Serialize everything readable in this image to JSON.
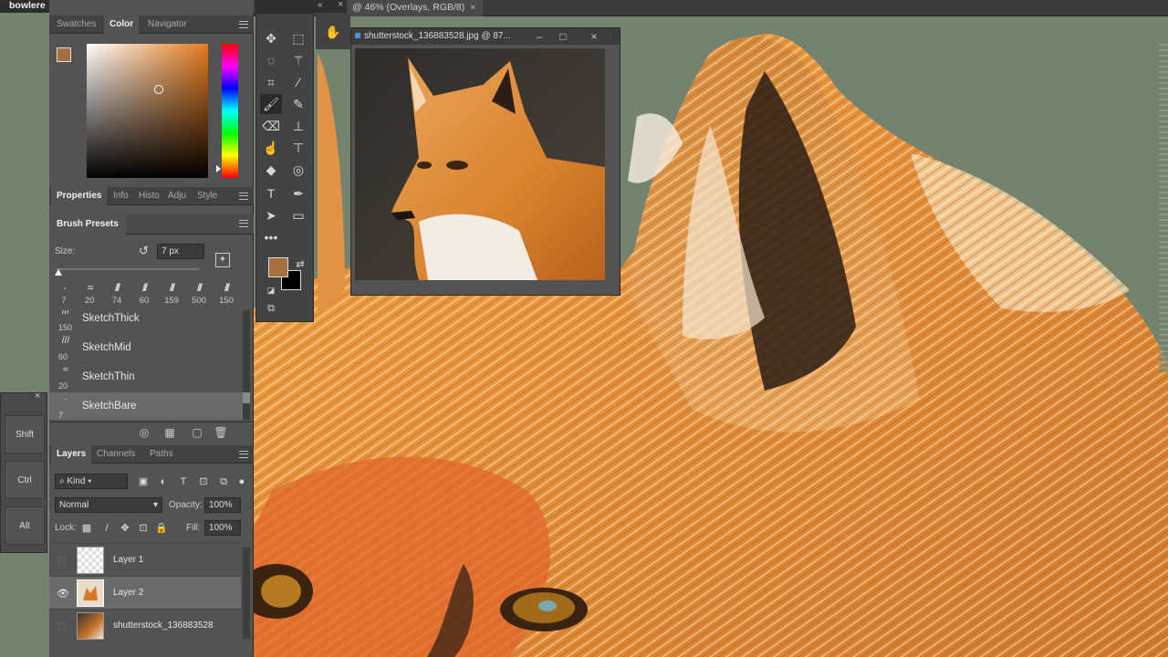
{
  "app": {
    "title": "bowlere"
  },
  "document": {
    "tab_label": "@ 46% (Overlays, RGB/8)",
    "close": "×"
  },
  "color_panel": {
    "tabs": [
      "Swatches",
      "Color",
      "Navigator"
    ],
    "active_tab": "Color",
    "foreground": "#a6703f",
    "background": "#000000",
    "hue_color": "#e47a1e"
  },
  "properties_panel": {
    "tabs": [
      "Properties",
      "Info",
      "Histo",
      "Adju",
      "Style"
    ],
    "active_tab": "Properties"
  },
  "brush_presets": {
    "title": "Brush Presets",
    "size_label": "Size:",
    "size_value": "7 px",
    "thumb_sizes": [
      "7",
      "20",
      "74",
      "60",
      "159",
      "500",
      "150"
    ],
    "presets": [
      {
        "name": "SketchThick",
        "size": "150"
      },
      {
        "name": "SketchMid",
        "size": "60"
      },
      {
        "name": "SketchThin",
        "size": "20"
      },
      {
        "name": "SketchBare",
        "size": "7"
      }
    ],
    "selected": "SketchBare"
  },
  "layers_panel": {
    "tabs": [
      "Layers",
      "Channels",
      "Paths"
    ],
    "active_tab": "Layers",
    "filter_kind": "Kind",
    "blend_mode": "Normal",
    "opacity_label": "Opacity:",
    "opacity": "100%",
    "lock_label": "Lock:",
    "fill_label": "Fill:",
    "fill": "100%",
    "layers": [
      {
        "name": "Layer 1",
        "visible": false,
        "selected": false
      },
      {
        "name": "Layer 2",
        "visible": true,
        "selected": true
      },
      {
        "name": "shutterstock_136883528",
        "visible": false,
        "selected": false
      }
    ]
  },
  "modifier_keys": [
    "Shift",
    "Ctrl",
    "Alt"
  ],
  "reference_window": {
    "title": "shutterstock_136883528.jpg @ 87..."
  },
  "toolbar": {
    "more": "•••"
  }
}
